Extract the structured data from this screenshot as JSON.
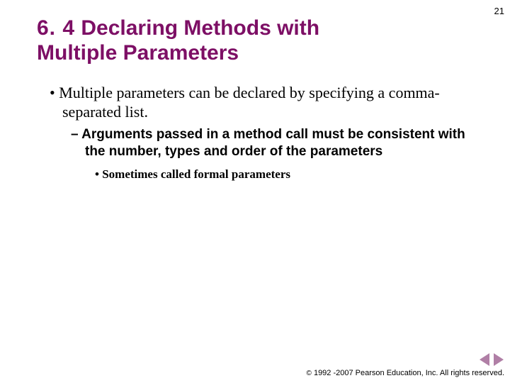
{
  "page_number": "21",
  "title_number": "6. 4",
  "title_text": "  Declaring Methods with Multiple Parameters",
  "bullets": {
    "l1": "Multiple parameters can be declared by specifying a comma-separated list.",
    "l2": "Arguments passed in a method call must be consistent with the number, types and order of the parameters",
    "l3": "Sometimes called formal parameters"
  },
  "footer": {
    "copyright_symbol": "©",
    "copyright_text": " 1992 -2007 Pearson Education, Inc.  All rights reserved."
  }
}
